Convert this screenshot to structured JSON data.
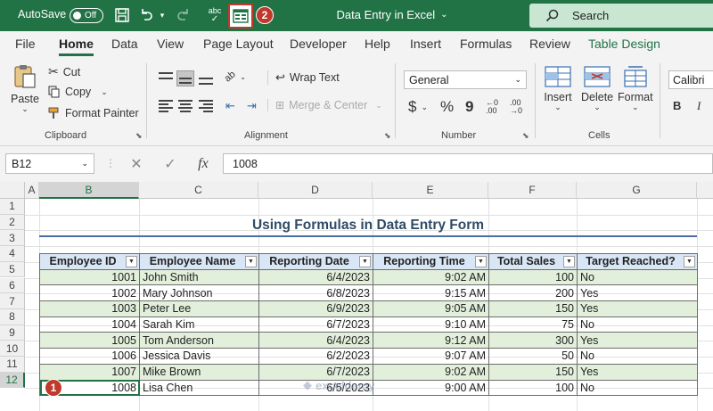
{
  "titlebar": {
    "autosave_label": "AutoSave",
    "autosave_state": "Off",
    "doc_title": "Data Entry in Excel",
    "search_label": "Search",
    "badge_2": "2",
    "accent": "#217346"
  },
  "menu": {
    "tabs": [
      "File",
      "Home",
      "Data",
      "View",
      "Page Layout",
      "Developer",
      "Help",
      "Insert",
      "Formulas",
      "Review",
      "Table Design"
    ],
    "active": "Home"
  },
  "ribbon": {
    "clipboard": {
      "paste": "Paste",
      "cut": "Cut",
      "copy": "Copy",
      "format_painter": "Format Painter",
      "label": "Clipboard"
    },
    "alignment": {
      "wrap_text": "Wrap Text",
      "merge_center": "Merge & Center",
      "label": "Alignment"
    },
    "number": {
      "format": "General",
      "currency": "$",
      "percent": "%",
      "comma": "9",
      "label": "Number"
    },
    "cells": {
      "insert": "Insert",
      "delete": "Delete",
      "format": "Format",
      "label": "Cells"
    },
    "font": {
      "name": "Calibri",
      "bold": "B"
    }
  },
  "formula_bar": {
    "name_box": "B12",
    "fx": "fx",
    "value": "1008"
  },
  "grid": {
    "columns": [
      "A",
      "B",
      "C",
      "D",
      "E",
      "F",
      "G"
    ],
    "selected_column": "B",
    "rows": [
      "1",
      "2",
      "3",
      "4",
      "5",
      "6",
      "7",
      "8",
      "9",
      "10",
      "11",
      "12"
    ],
    "selected_row": "12"
  },
  "sheet": {
    "title": "Using Formulas in Data Entry Form",
    "headers": [
      "Employee ID",
      "Employee Name",
      "Reporting Date",
      "Reporting Time",
      "Total Sales",
      "Target Reached?"
    ],
    "rows": [
      [
        "1001",
        "John Smith",
        "6/4/2023",
        "9:02 AM",
        "100",
        "No"
      ],
      [
        "1002",
        "Mary Johnson",
        "6/8/2023",
        "9:15 AM",
        "200",
        "Yes"
      ],
      [
        "1003",
        "Peter Lee",
        "6/9/2023",
        "9:05 AM",
        "150",
        "Yes"
      ],
      [
        "1004",
        "Sarah Kim",
        "6/7/2023",
        "9:10 AM",
        "75",
        "No"
      ],
      [
        "1005",
        "Tom Anderson",
        "6/4/2023",
        "9:12 AM",
        "300",
        "Yes"
      ],
      [
        "1006",
        "Jessica Davis",
        "6/2/2023",
        "9:07 AM",
        "50",
        "No"
      ],
      [
        "1007",
        "Mike Brown",
        "6/7/2023",
        "9:02 AM",
        "150",
        "Yes"
      ],
      [
        "1008",
        "Lisa Chen",
        "6/5/2023",
        "9:00 AM",
        "100",
        "No"
      ]
    ],
    "badge_1": "1"
  },
  "watermark": "exceldemy"
}
